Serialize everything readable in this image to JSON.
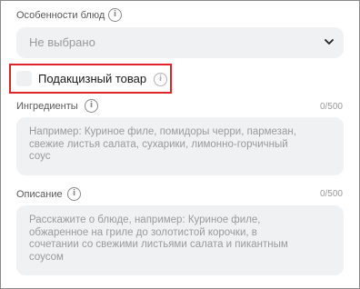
{
  "dish_features": {
    "label": "Особенности блюд",
    "select_value": "Не выбрано"
  },
  "excise": {
    "label": "Подакцизный товар"
  },
  "ingredients": {
    "label": "Ингредиенты",
    "counter": "0/500",
    "placeholder": "Например:  Куриное филе, помидоры черри, пармезан,\nсвежие листья салата, сухарики, лимонно-горчичный\nсоус"
  },
  "description": {
    "label": "Описание",
    "counter": "0/500",
    "placeholder": "Расскажите о блюде, например: Куриное филе,\nобжаренное на гриле до золотистой корочки, в\nсочетании со свежими листьями салата и пикантным\nсоусом"
  },
  "icons": {
    "info": "info-icon",
    "chevron": "chevron-down-icon"
  },
  "colors": {
    "highlight_border": "#e0242b",
    "field_bg": "#f0f1f3",
    "placeholder_text": "#9a9a9a"
  }
}
